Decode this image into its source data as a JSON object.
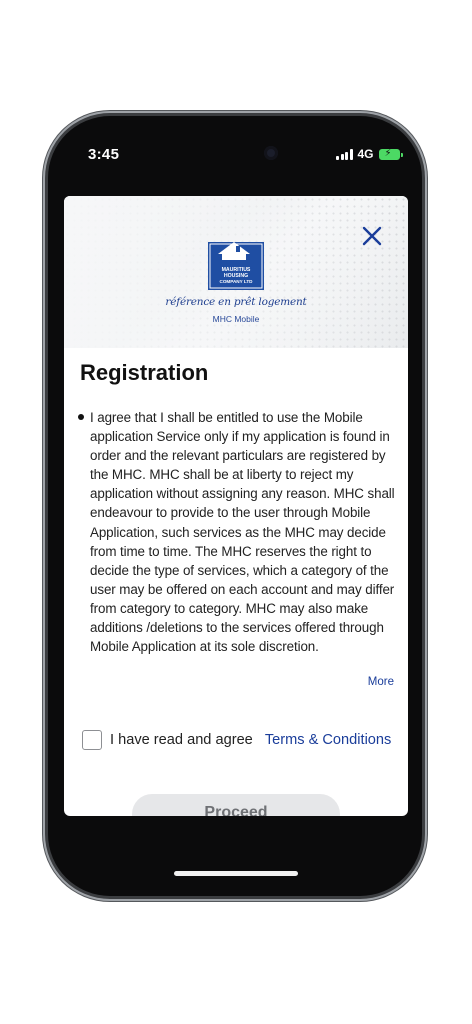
{
  "status_bar": {
    "time": "3:45",
    "network": "4G",
    "battery_color": "#4cd964"
  },
  "header": {
    "close_icon": "close-icon",
    "logo_icon": "mhc-logo-icon",
    "logo_text": [
      "MAURITIUS",
      "HOUSING",
      "COMPANY LTD"
    ],
    "tagline": "référence en prêt logement",
    "app_name": "MHC Mobile"
  },
  "main": {
    "title": "Registration",
    "terms_text": "I agree that I shall be entitled to use the Mobile application Service only if my application is found in order and the relevant particulars are registered by the MHC. MHC shall be at liberty to reject my application without assigning any reason. MHC shall endeavour to provide to the user through Mobile Application, such services as the MHC may decide from time to time. The MHC reserves the right to decide the type of services, which a category of the user may be offered on each account and may differ from category to category. MHC may also make additions /deletions to the services offered through Mobile Application at its sole discretion.",
    "more_label": "More",
    "agree_label": "I have read and agree",
    "terms_link_label": "Terms & Conditions",
    "proceed_label": "Proceed"
  },
  "colors": {
    "accent": "#1a3d9a",
    "logo_blue": "#1f4ea3"
  }
}
